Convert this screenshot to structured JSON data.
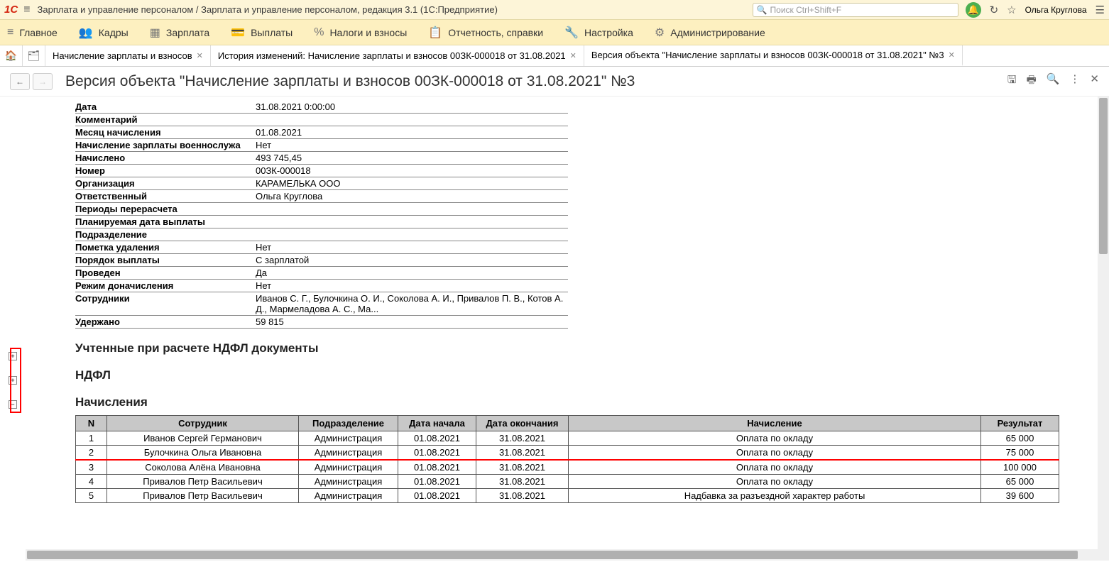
{
  "title_bar": {
    "logo": "1C",
    "app_title": "Зарплата и управление персоналом / Зарплата и управление персоналом, редакция 3.1  (1С:Предприятие)",
    "search_placeholder": "Поиск Ctrl+Shift+F",
    "user_name": "Ольга Круглова"
  },
  "nav": {
    "items": [
      {
        "icon": "≡",
        "label": "Главное"
      },
      {
        "icon": "👥",
        "label": "Кадры"
      },
      {
        "icon": "▦",
        "label": "Зарплата"
      },
      {
        "icon": "💳",
        "label": "Выплаты"
      },
      {
        "icon": "%",
        "label": "Налоги и взносы"
      },
      {
        "icon": "📋",
        "label": "Отчетность, справки"
      },
      {
        "icon": "🔧",
        "label": "Настройка"
      },
      {
        "icon": "⚙",
        "label": "Администрирование"
      }
    ]
  },
  "tabs": [
    {
      "label": "Начисление зарплаты и взносов",
      "close": true
    },
    {
      "label": "История изменений: Начисление зарплаты и взносов 00ЗК-000018 от 31.08.2021",
      "close": true
    },
    {
      "label": "Версия объекта \"Начисление зарплаты и взносов 00ЗК-000018 от 31.08.2021\" №3",
      "close": true,
      "active": true
    }
  ],
  "page_title": "Версия объекта \"Начисление зарплаты и взносов 00ЗК-000018 от 31.08.2021\" №3",
  "meta": [
    {
      "label": "Дата",
      "value": "31.08.2021 0:00:00"
    },
    {
      "label": "Комментарий",
      "value": ""
    },
    {
      "label": "Месяц начисления",
      "value": "01.08.2021"
    },
    {
      "label": "Начисление зарплаты военнослужа",
      "value": "Нет"
    },
    {
      "label": "Начислено",
      "value": "493 745,45"
    },
    {
      "label": "Номер",
      "value": "00ЗК-000018"
    },
    {
      "label": "Организация",
      "value": "КАРАМЕЛЬКА ООО"
    },
    {
      "label": "Ответственный",
      "value": "Ольга Круглова"
    },
    {
      "label": "Периоды перерасчета",
      "value": ""
    },
    {
      "label": "Планируемая дата выплаты",
      "value": ""
    },
    {
      "label": "Подразделение",
      "value": ""
    },
    {
      "label": "Пометка удаления",
      "value": "Нет"
    },
    {
      "label": "Порядок выплаты",
      "value": "С зарплатой"
    },
    {
      "label": "Проведен",
      "value": "Да"
    },
    {
      "label": "Режим доначисления",
      "value": "Нет"
    },
    {
      "label": "Сотрудники",
      "value": "Иванов С. Г., Булочкина О. И., Соколова А. И., Привалов П. В., Котов А. Д., Мармеладова А. С., Ма..."
    },
    {
      "label": "Удержано",
      "value": "59 815"
    }
  ],
  "sections": {
    "s1": "Учтенные при расчете НДФЛ документы",
    "s2": "НДФЛ",
    "s3": "Начисления"
  },
  "table": {
    "headers": [
      "N",
      "Сотрудник",
      "Подразделение",
      "Дата начала",
      "Дата окончания",
      "Начисление",
      "Результат"
    ],
    "rows": [
      {
        "n": "1",
        "emp": "Иванов Сергей Германович",
        "dep": "Администрация",
        "d1": "01.08.2021",
        "d2": "31.08.2021",
        "acc": "Оплата по окладу",
        "res": "65 000"
      },
      {
        "n": "2",
        "emp": "Булочкина Ольга Ивановна",
        "dep": "Администрация",
        "d1": "01.08.2021",
        "d2": "31.08.2021",
        "acc": "Оплата по окладу",
        "res": "75 000",
        "red": true
      },
      {
        "n": "3",
        "emp": "Соколова Алёна Ивановна",
        "dep": "Администрация",
        "d1": "01.08.2021",
        "d2": "31.08.2021",
        "acc": "Оплата по окладу",
        "res": "100 000"
      },
      {
        "n": "4",
        "emp": "Привалов Петр Васильевич",
        "dep": "Администрация",
        "d1": "01.08.2021",
        "d2": "31.08.2021",
        "acc": "Оплата по окладу",
        "res": "65 000"
      },
      {
        "n": "5",
        "emp": "Привалов Петр Васильевич",
        "dep": "Администрация",
        "d1": "01.08.2021",
        "d2": "31.08.2021",
        "acc": "Надбавка за разъездной характер работы",
        "res": "39 600"
      }
    ]
  }
}
